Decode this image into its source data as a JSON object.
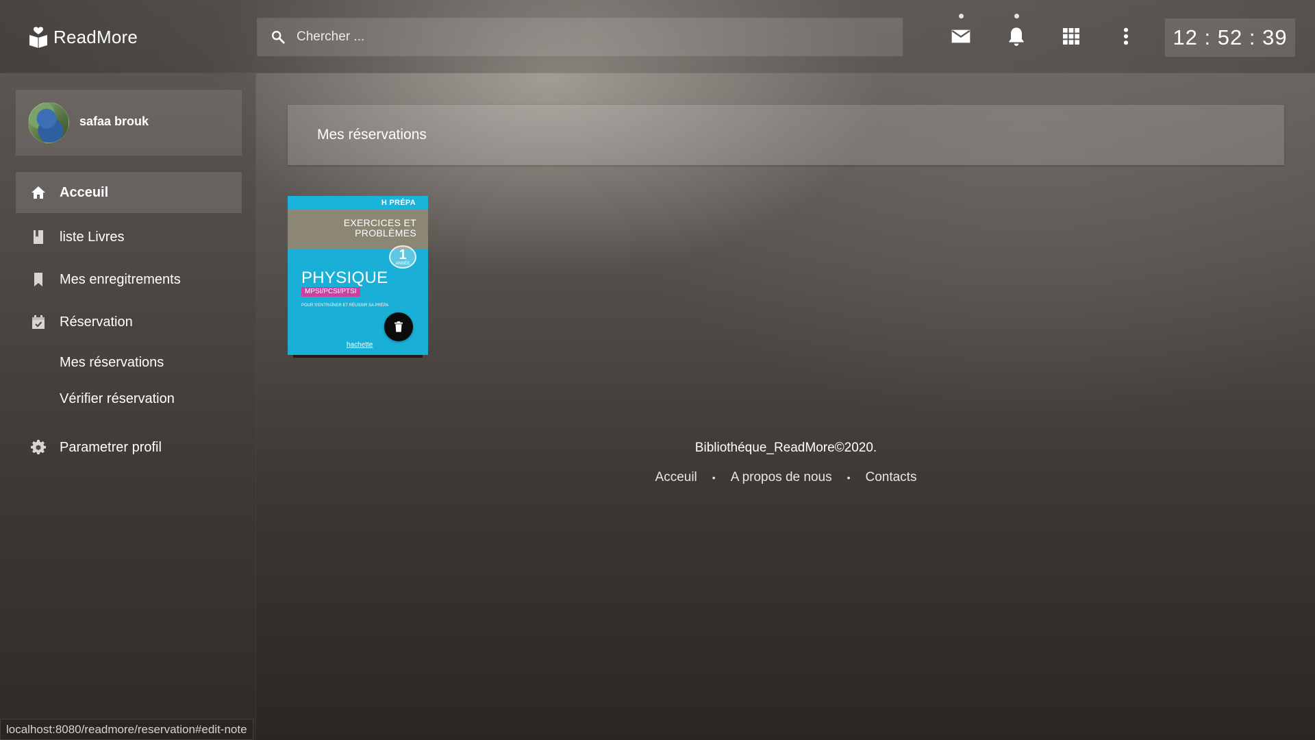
{
  "app": {
    "name": "ReadMore",
    "icon": "open-book-heart-icon"
  },
  "search": {
    "placeholder": "Chercher ...",
    "value": ""
  },
  "topbar": {
    "icons": [
      "mail-icon",
      "bell-icon",
      "apps-grid-icon",
      "more-vert-icon"
    ],
    "clock": "12 : 52 : 39"
  },
  "sidebar": {
    "user": {
      "name": "safaa brouk"
    },
    "items": [
      {
        "label": "Acceuil",
        "icon": "home-icon",
        "active": true
      },
      {
        "label": "liste Livres",
        "icon": "book-icon"
      },
      {
        "label": "Mes enregitrements",
        "icon": "bookmark-icon"
      },
      {
        "label": "Réservation",
        "icon": "calendar-check-icon"
      }
    ],
    "subitems": [
      {
        "label": "Mes réservations"
      },
      {
        "label": "Vérifier réservation"
      }
    ],
    "settings": {
      "label": "Parametrer profil",
      "icon": "gear-icon"
    }
  },
  "main": {
    "title": "Mes réservations",
    "books": [
      {
        "cover": {
          "series": "H PRÉPA",
          "subtitle": "EXERCICES ET PROBLÈMES",
          "badge_num": "1",
          "badge_txt": "ANNÉE",
          "title": "PHYSIQUE",
          "tag": "MPSI/PCSI/PTSI",
          "blurb": "POUR S'ENTRAÎNER ET RÉUSSIR SA PRÉPA",
          "publisher": "hachette"
        },
        "delete_icon": "trash-icon"
      }
    ]
  },
  "footer": {
    "copyright": "Bibliothéque_ReadMore©2020.",
    "links": [
      "Acceuil",
      "A propos de nous",
      "Contacts"
    ],
    "separator": "•"
  },
  "statusbar": {
    "url": "localhost:8080/readmore/reservation#edit-note"
  },
  "colors": {
    "cover_blue": "#1aafd6",
    "cover_band": "#8c8775",
    "tag_pink": "#c843a0"
  }
}
